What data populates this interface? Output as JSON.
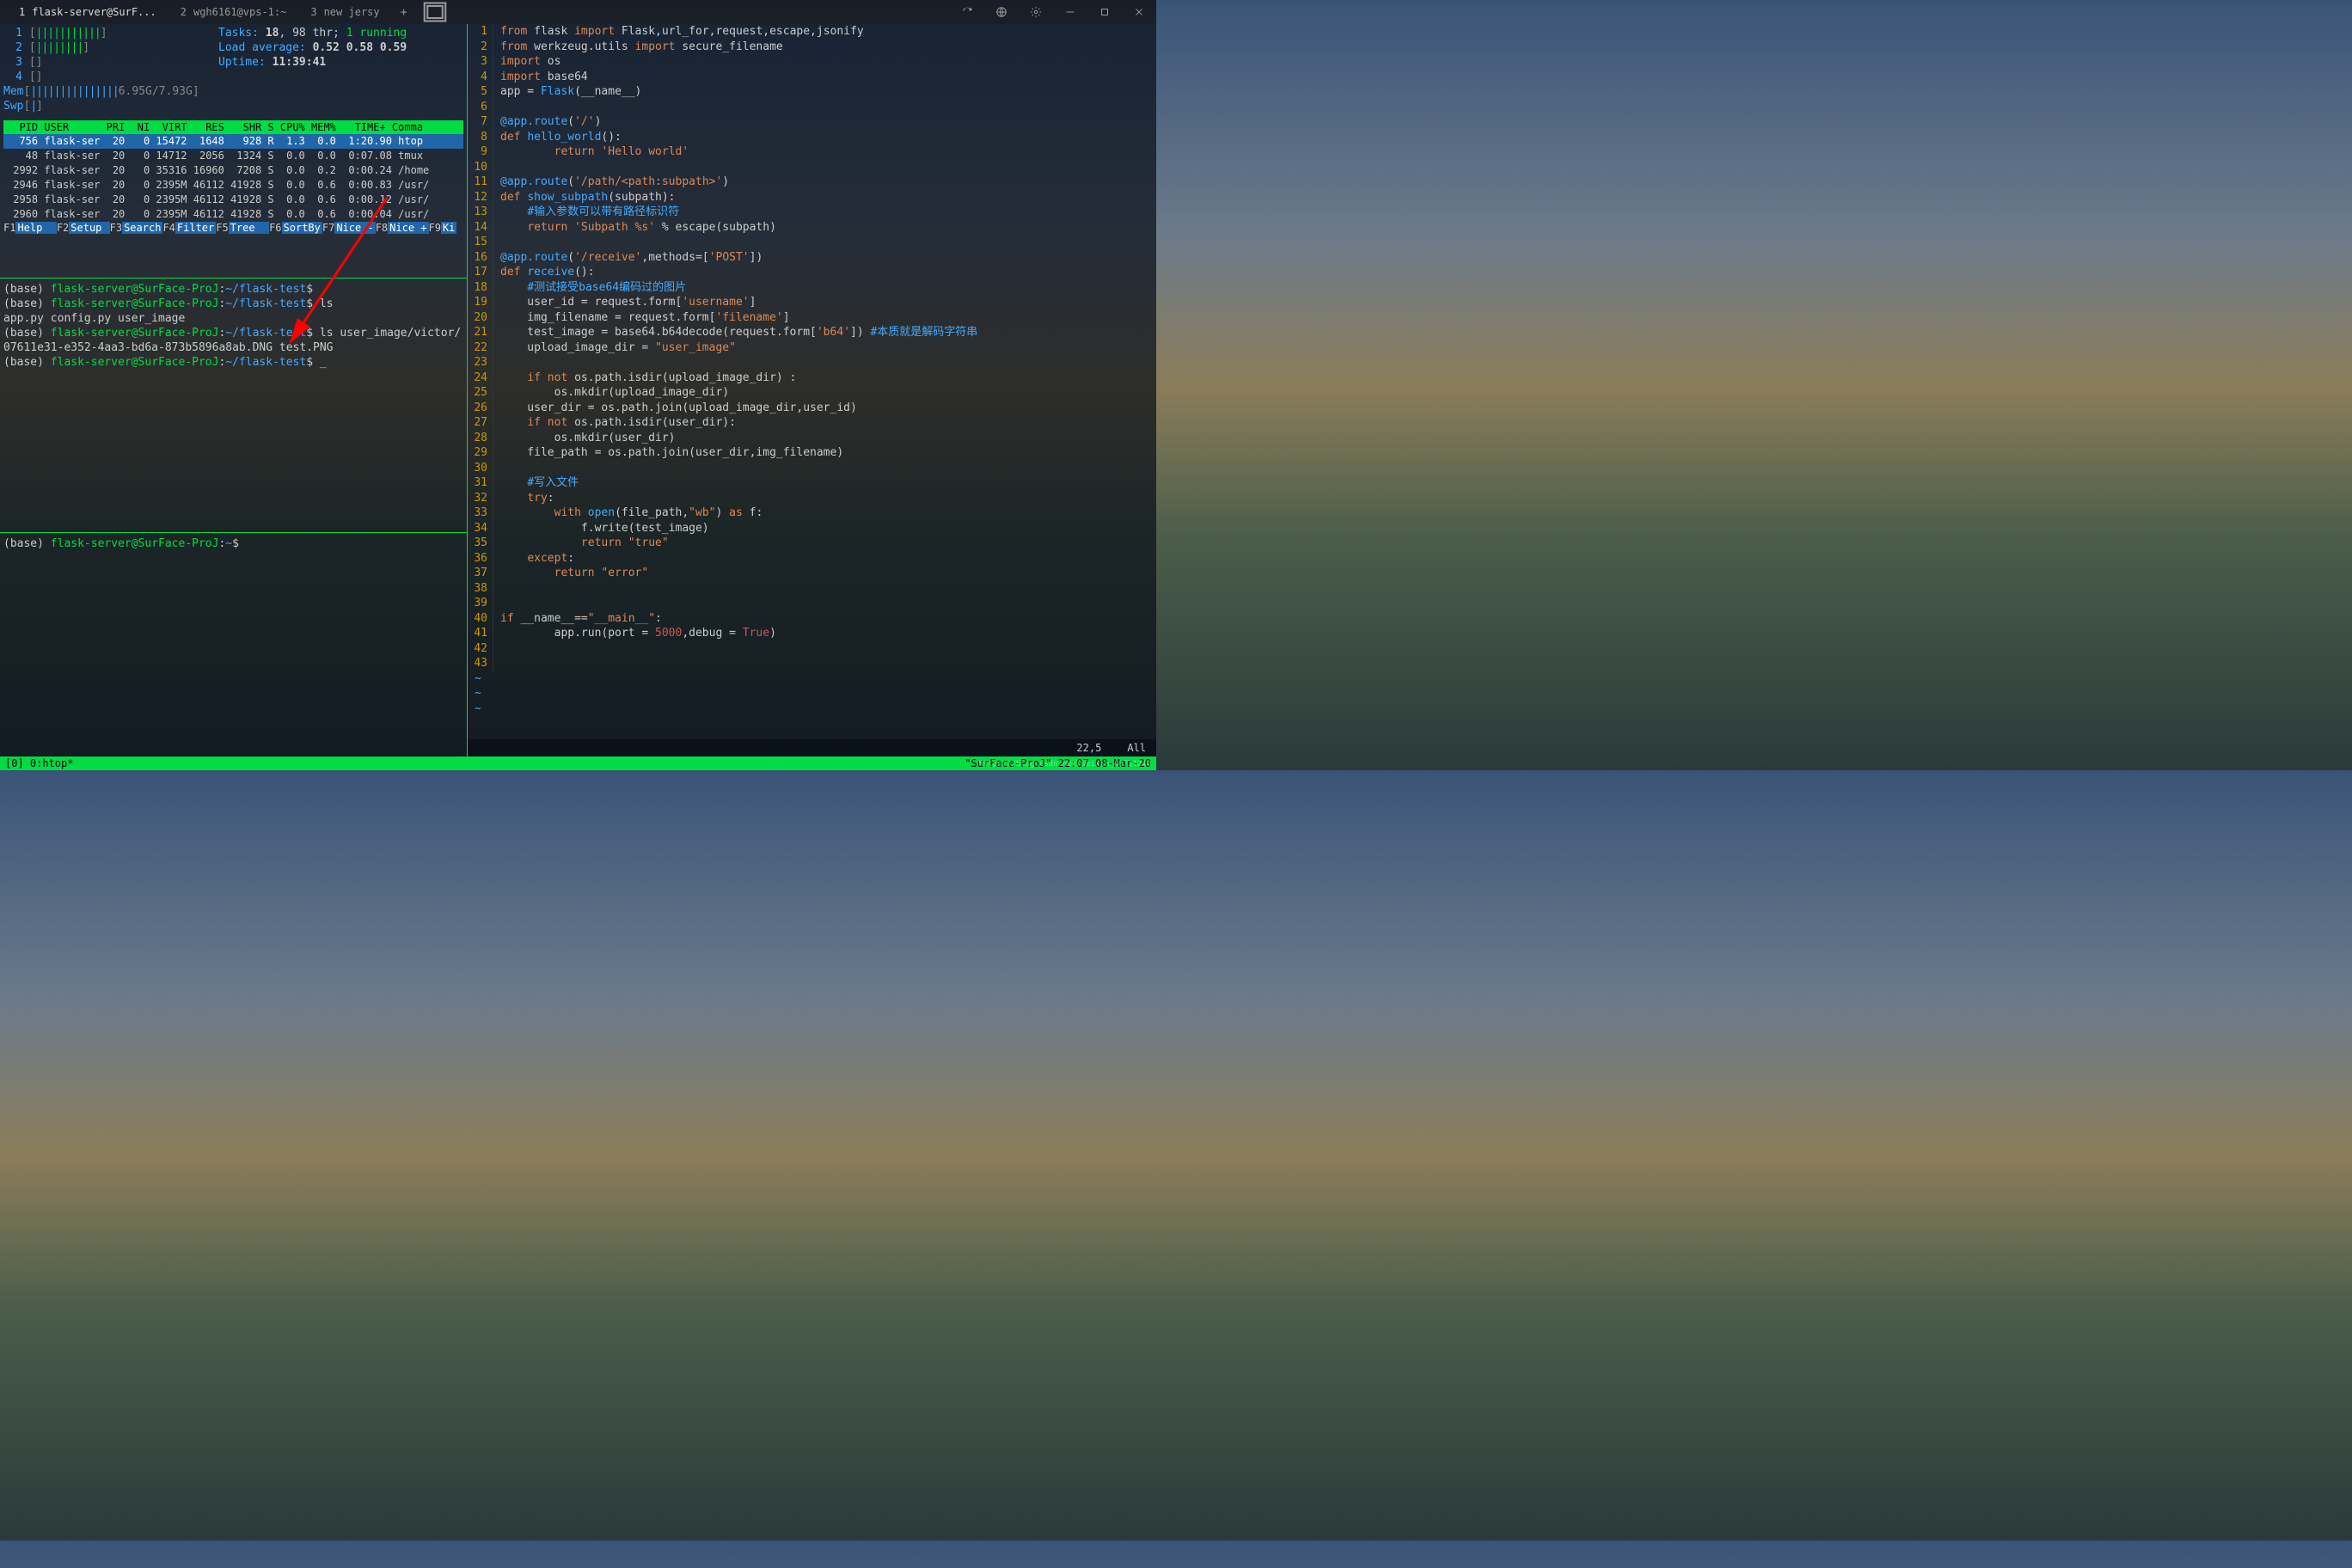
{
  "titlebar": {
    "tabs": [
      {
        "num": "1",
        "label": "flask-server@SurF..."
      },
      {
        "num": "2",
        "label": "wgh6161@vps-1:~"
      },
      {
        "num": "3",
        "label": "new jersy"
      }
    ]
  },
  "htop": {
    "cpu": [
      {
        "n": "1",
        "fill": "|||||||||||",
        "val": ""
      },
      {
        "n": "2",
        "fill": "||||||||",
        "val": ""
      },
      {
        "n": "3",
        "fill": "",
        "val": ""
      },
      {
        "n": "4",
        "fill": "",
        "val": ""
      }
    ],
    "mem": {
      "label": "Mem",
      "fill": "|||||||||||||||",
      "val": "6.95G/7.93G"
    },
    "swp": {
      "label": "Swp",
      "fill": "|",
      "val": ""
    },
    "tasks_label": "Tasks: ",
    "tasks": "18",
    "thr": ", 98 thr; ",
    "running": "1",
    "running_lbl": " running",
    "load_label": "Load average: ",
    "load": "0.52 0.58 0.59",
    "uptime_label": "Uptime: ",
    "uptime": "11:39:41",
    "header": "  PID USER      PRI  NI  VIRT   RES   SHR S CPU% MEM%   TIME+ Comma",
    "rows": [
      {
        "sel": true,
        "txt": "  756 flask-ser  20   0 15472  1648   928 R  1.3  0.0  1:20.90 htop "
      },
      {
        "sel": false,
        "txt": "   48 flask-ser  20   0 14712  2056  1324 S  0.0  0.0  0:07.08 tmux "
      },
      {
        "sel": false,
        "txt": " 2992 flask-ser  20   0 35316 16960  7208 S  0.0  0.2  0:00.24 /home"
      },
      {
        "sel": false,
        "txt": " 2946 flask-ser  20   0 2395M 46112 41928 S  0.0  0.6  0:00.83 /usr/"
      },
      {
        "sel": false,
        "txt": " 2958 flask-ser  20   0 2395M 46112 41928 S  0.0  0.6  0:00.12 /usr/"
      },
      {
        "sel": false,
        "txt": " 2960 flask-ser  20   0 2395M 46112 41928 S  0.0  0.6  0:00.04 /usr/"
      }
    ],
    "fkeys": [
      {
        "k": "F1",
        "l": "Help  "
      },
      {
        "k": "F2",
        "l": "Setup "
      },
      {
        "k": "F3",
        "l": "Search"
      },
      {
        "k": "F4",
        "l": "Filter"
      },
      {
        "k": "F5",
        "l": "Tree  "
      },
      {
        "k": "F6",
        "l": "SortBy"
      },
      {
        "k": "F7",
        "l": "Nice -"
      },
      {
        "k": "F8",
        "l": "Nice +"
      },
      {
        "k": "F9",
        "l": "Ki"
      }
    ]
  },
  "shell": {
    "lines": [
      {
        "env": "(base) ",
        "user": "flask-server@SurFace-ProJ",
        "sep": ":",
        "path": "~/flask-test",
        "p": "$"
      },
      {
        "env": "(base) ",
        "user": "flask-server@SurFace-ProJ",
        "sep": ":",
        "path": "~/flask-test",
        "p": "$",
        "cmd": " ls"
      },
      {
        "out": "app.py  config.py  user_image"
      },
      {
        "env": "(base) ",
        "user": "flask-server@SurFace-ProJ",
        "sep": ":",
        "path": "~/flask-test",
        "p": "$",
        "cmd": " ls user_image/victor/"
      },
      {
        "out": "07611e31-e352-4aa3-bd6a-873b5896a8ab.DNG  test.PNG"
      },
      {
        "env": "(base) ",
        "user": "flask-server@SurFace-ProJ",
        "sep": ":",
        "path": "~/flask-test",
        "p": "$",
        "cmd": " _"
      }
    ],
    "bottom": {
      "env": "(base) ",
      "user": "flask-server@SurFace-ProJ",
      "sep": ":",
      "path": "~",
      "p": "$"
    }
  },
  "code": [
    {
      "n": 1,
      "seg": [
        [
          "kw",
          "from"
        ],
        [
          "name",
          " flask "
        ],
        [
          "kw",
          "import"
        ],
        [
          "name",
          " Flask,url_for,request,escape,jsonify"
        ]
      ]
    },
    {
      "n": 2,
      "seg": [
        [
          "kw",
          "from"
        ],
        [
          "name",
          " werkzeug.utils "
        ],
        [
          "kw",
          "import"
        ],
        [
          "name",
          " secure_filename"
        ]
      ]
    },
    {
      "n": 3,
      "seg": [
        [
          "kw",
          "import"
        ],
        [
          "name",
          " os"
        ]
      ]
    },
    {
      "n": 4,
      "seg": [
        [
          "kw",
          "import"
        ],
        [
          "name",
          " base64"
        ]
      ]
    },
    {
      "n": 5,
      "seg": [
        [
          "name",
          "app = "
        ],
        [
          "fn",
          "Flask"
        ],
        [
          "name",
          "(__name__)"
        ]
      ]
    },
    {
      "n": 6,
      "seg": []
    },
    {
      "n": 7,
      "seg": [
        [
          "fn",
          "@app.route"
        ],
        [
          "name",
          "("
        ],
        [
          "str",
          "'/'"
        ],
        [
          "name",
          ")"
        ]
      ]
    },
    {
      "n": 8,
      "seg": [
        [
          "kw",
          "def"
        ],
        [
          "name",
          " "
        ],
        [
          "fn",
          "hello_world"
        ],
        [
          "name",
          "():"
        ]
      ]
    },
    {
      "n": 9,
      "seg": [
        [
          "name",
          "        "
        ],
        [
          "kw",
          "return"
        ],
        [
          "name",
          " "
        ],
        [
          "str",
          "'Hello world'"
        ]
      ]
    },
    {
      "n": 10,
      "seg": []
    },
    {
      "n": 11,
      "seg": [
        [
          "fn",
          "@app.route"
        ],
        [
          "name",
          "("
        ],
        [
          "str",
          "'/path/<path:subpath>'"
        ],
        [
          "name",
          ")"
        ]
      ]
    },
    {
      "n": 12,
      "seg": [
        [
          "kw",
          "def"
        ],
        [
          "name",
          " "
        ],
        [
          "fn",
          "show_subpath"
        ],
        [
          "name",
          "(subpath):"
        ]
      ]
    },
    {
      "n": 13,
      "seg": [
        [
          "name",
          "    "
        ],
        [
          "cmt",
          "#输入参数可以带有路径标识符"
        ]
      ]
    },
    {
      "n": 14,
      "seg": [
        [
          "name",
          "    "
        ],
        [
          "kw",
          "return"
        ],
        [
          "name",
          " "
        ],
        [
          "str",
          "'Subpath %s'"
        ],
        [
          "name",
          " % escape(subpath)"
        ]
      ]
    },
    {
      "n": 15,
      "seg": []
    },
    {
      "n": 16,
      "seg": [
        [
          "fn",
          "@app.route"
        ],
        [
          "name",
          "("
        ],
        [
          "str",
          "'/receive'"
        ],
        [
          "name",
          ",methods=["
        ],
        [
          "str",
          "'POST'"
        ],
        [
          "name",
          "])"
        ]
      ]
    },
    {
      "n": 17,
      "seg": [
        [
          "kw",
          "def"
        ],
        [
          "name",
          " "
        ],
        [
          "fn",
          "receive"
        ],
        [
          "name",
          "():"
        ]
      ]
    },
    {
      "n": 18,
      "seg": [
        [
          "name",
          "    "
        ],
        [
          "cmt",
          "#测试接受base64编码过的图片"
        ]
      ]
    },
    {
      "n": 19,
      "seg": [
        [
          "name",
          "    user_id = request.form["
        ],
        [
          "str",
          "'username'"
        ],
        [
          "name",
          "]"
        ]
      ]
    },
    {
      "n": 20,
      "seg": [
        [
          "name",
          "    img_filename = request.form["
        ],
        [
          "str",
          "'filename'"
        ],
        [
          "name",
          "]"
        ]
      ]
    },
    {
      "n": 21,
      "seg": [
        [
          "name",
          "    test_image = base64.b64decode(request.form["
        ],
        [
          "str",
          "'b64'"
        ],
        [
          "name",
          "]) "
        ],
        [
          "cmt",
          "#本质就是解码字符串"
        ]
      ]
    },
    {
      "n": 22,
      "seg": [
        [
          "name",
          "    upload_image_dir = "
        ],
        [
          "str",
          "\"user_image\""
        ]
      ]
    },
    {
      "n": 23,
      "seg": []
    },
    {
      "n": 24,
      "seg": [
        [
          "name",
          "    "
        ],
        [
          "kw",
          "if not"
        ],
        [
          "name",
          " os.path.isdir(upload_image_dir) :"
        ]
      ]
    },
    {
      "n": 25,
      "seg": [
        [
          "name",
          "        os.mkdir(upload_image_dir)"
        ]
      ]
    },
    {
      "n": 26,
      "seg": [
        [
          "name",
          "    user_dir = os.path.join(upload_image_dir,user_id)"
        ]
      ]
    },
    {
      "n": 27,
      "seg": [
        [
          "name",
          "    "
        ],
        [
          "kw",
          "if not"
        ],
        [
          "name",
          " os.path.isdir(user_dir):"
        ]
      ]
    },
    {
      "n": 28,
      "seg": [
        [
          "name",
          "        os.mkdir(user_dir)"
        ]
      ]
    },
    {
      "n": 29,
      "seg": [
        [
          "name",
          "    file_path = os.path.join(user_dir,img_filename)"
        ]
      ]
    },
    {
      "n": 30,
      "seg": []
    },
    {
      "n": 31,
      "seg": [
        [
          "name",
          "    "
        ],
        [
          "cmt",
          "#写入文件"
        ]
      ]
    },
    {
      "n": 32,
      "seg": [
        [
          "name",
          "    "
        ],
        [
          "kw",
          "try"
        ],
        [
          "name",
          ":"
        ]
      ]
    },
    {
      "n": 33,
      "seg": [
        [
          "name",
          "        "
        ],
        [
          "kw",
          "with"
        ],
        [
          "name",
          " "
        ],
        [
          "fn",
          "open"
        ],
        [
          "name",
          "(file_path,"
        ],
        [
          "str",
          "\"wb\""
        ],
        [
          "name",
          ") "
        ],
        [
          "kw",
          "as"
        ],
        [
          "name",
          " f:"
        ]
      ]
    },
    {
      "n": 34,
      "seg": [
        [
          "name",
          "            f.write(test_image)"
        ]
      ]
    },
    {
      "n": 35,
      "seg": [
        [
          "name",
          "            "
        ],
        [
          "kw",
          "return"
        ],
        [
          "name",
          " "
        ],
        [
          "str",
          "\"true\""
        ]
      ]
    },
    {
      "n": 36,
      "seg": [
        [
          "name",
          "    "
        ],
        [
          "kw",
          "except"
        ],
        [
          "name",
          ":"
        ]
      ]
    },
    {
      "n": 37,
      "seg": [
        [
          "name",
          "        "
        ],
        [
          "kw",
          "return"
        ],
        [
          "name",
          " "
        ],
        [
          "str",
          "\"error\""
        ]
      ]
    },
    {
      "n": 38,
      "seg": []
    },
    {
      "n": 39,
      "seg": []
    },
    {
      "n": 40,
      "seg": [
        [
          "kw",
          "if"
        ],
        [
          "name",
          " __name__=="
        ],
        [
          "str",
          "\"__main__\""
        ],
        [
          "name",
          ":"
        ]
      ]
    },
    {
      "n": 41,
      "seg": [
        [
          "name",
          "        app.run(port = "
        ],
        [
          "num",
          "5000"
        ],
        [
          "name",
          ",debug = "
        ],
        [
          "bool",
          "True"
        ],
        [
          "name",
          ")"
        ]
      ]
    },
    {
      "n": 42,
      "seg": []
    },
    {
      "n": 43,
      "seg": []
    }
  ],
  "vim_status": {
    "pos": "22,5",
    "view": "All"
  },
  "tmux": {
    "left": "[0] 0:htop*",
    "right": "\"SurFace-ProJ\" 22:07 08-Mar-20"
  },
  "watermark": "https://blog.csdn.net/weixin_40731240"
}
